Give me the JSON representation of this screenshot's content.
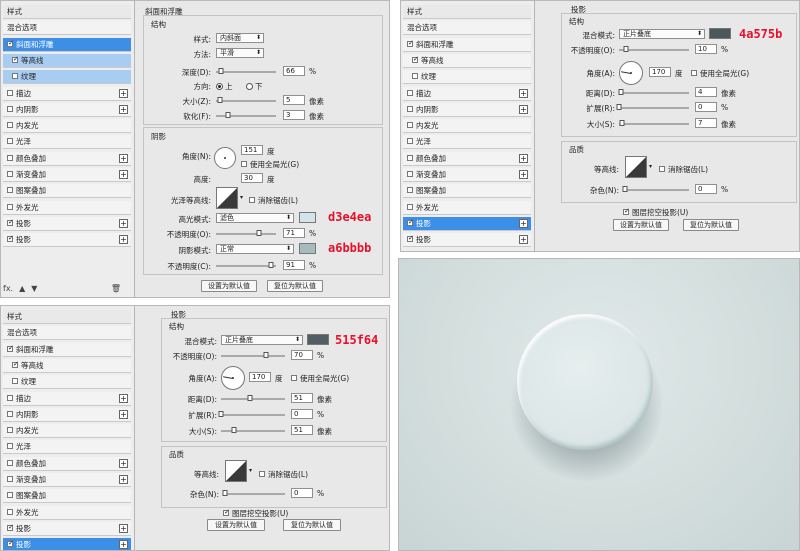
{
  "panel1": {
    "stylelist": {
      "items": [
        {
          "label": "样式",
          "checkbox": false,
          "checked": false,
          "plus": false
        },
        {
          "label": "混合选项",
          "checkbox": false,
          "checked": false,
          "plus": false
        },
        {
          "label": "斜面和浮雕",
          "checkbox": true,
          "checked": true,
          "plus": false,
          "selected": true
        },
        {
          "label": "等高线",
          "checkbox": true,
          "checked": true,
          "plus": false,
          "sub": true
        },
        {
          "label": "纹理",
          "checkbox": true,
          "checked": false,
          "plus": false,
          "sub": true
        },
        {
          "label": "描边",
          "checkbox": true,
          "checked": false,
          "plus": true
        },
        {
          "label": "内阴影",
          "checkbox": true,
          "checked": false,
          "plus": true
        },
        {
          "label": "内发光",
          "checkbox": true,
          "checked": false,
          "plus": false
        },
        {
          "label": "光泽",
          "checkbox": true,
          "checked": false,
          "plus": false
        },
        {
          "label": "颜色叠加",
          "checkbox": true,
          "checked": false,
          "plus": true
        },
        {
          "label": "渐变叠加",
          "checkbox": true,
          "checked": false,
          "plus": true
        },
        {
          "label": "图案叠加",
          "checkbox": true,
          "checked": false,
          "plus": false
        },
        {
          "label": "外发光",
          "checkbox": true,
          "checked": false,
          "plus": false
        },
        {
          "label": "投影",
          "checkbox": true,
          "checked": true,
          "plus": true
        },
        {
          "label": "投影",
          "checkbox": true,
          "checked": true,
          "plus": true
        }
      ],
      "footer_fx": "fx."
    },
    "title": "斜面和浮雕",
    "structure": {
      "heading": "结构",
      "style_label": "样式:",
      "style_value": "内斜面",
      "technique_label": "方法:",
      "technique_value": "平滑",
      "depth_label": "深度(D):",
      "depth_value": "66",
      "depth_unit": "%",
      "direction_label": "方向:",
      "direction_up": "上",
      "direction_down": "下",
      "size_label": "大小(Z):",
      "size_value": "5",
      "size_unit": "像素",
      "soften_label": "软化(F):",
      "soften_value": "3",
      "soften_unit": "像素"
    },
    "shading": {
      "heading": "阴影",
      "angle_label": "角度(N):",
      "angle_value": "151",
      "angle_unit": "度",
      "global_light": "使用全局光(G)",
      "altitude_label": "高度:",
      "altitude_value": "30",
      "altitude_unit": "度",
      "gloss_label": "光泽等高线:",
      "anti_alias": "消除锯齿(L)",
      "highlight_label": "高光模式:",
      "highlight_mode": "滤色",
      "highlight_color": "#d3e4ea",
      "highlight_hex": "d3e4ea",
      "opacity_label": "不透明度(O):",
      "highlight_opacity": "71",
      "shadow_label": "阴影模式:",
      "shadow_mode": "正常",
      "shadow_color": "#a6bbbb",
      "shadow_hex": "a6bbbb",
      "shadow_opacity_label": "不透明度(C):",
      "shadow_opacity": "91",
      "percent": "%"
    },
    "buttons": {
      "make_default": "设置为默认值",
      "reset_default": "复位为默认值"
    }
  },
  "panel2": {
    "stylelist": {
      "items": [
        {
          "label": "样式",
          "checkbox": false,
          "checked": false,
          "plus": false
        },
        {
          "label": "混合选项",
          "checkbox": false,
          "checked": false,
          "plus": false
        },
        {
          "label": "斜面和浮雕",
          "checkbox": true,
          "checked": true,
          "plus": false
        },
        {
          "label": "等高线",
          "checkbox": true,
          "checked": true,
          "plus": false,
          "sub": true
        },
        {
          "label": "纹理",
          "checkbox": true,
          "checked": false,
          "plus": false,
          "sub": true
        },
        {
          "label": "描边",
          "checkbox": true,
          "checked": false,
          "plus": true
        },
        {
          "label": "内阴影",
          "checkbox": true,
          "checked": false,
          "plus": true
        },
        {
          "label": "内发光",
          "checkbox": true,
          "checked": false,
          "plus": false
        },
        {
          "label": "光泽",
          "checkbox": true,
          "checked": false,
          "plus": false
        },
        {
          "label": "颜色叠加",
          "checkbox": true,
          "checked": false,
          "plus": true
        },
        {
          "label": "渐变叠加",
          "checkbox": true,
          "checked": false,
          "plus": true
        },
        {
          "label": "图案叠加",
          "checkbox": true,
          "checked": false,
          "plus": false
        },
        {
          "label": "外发光",
          "checkbox": true,
          "checked": false,
          "plus": false
        },
        {
          "label": "投影",
          "checkbox": true,
          "checked": true,
          "plus": true,
          "selected": true
        },
        {
          "label": "投影",
          "checkbox": true,
          "checked": true,
          "plus": true
        }
      ]
    },
    "title": "投影",
    "structure": {
      "heading": "结构",
      "blend_label": "混合模式:",
      "blend_value": "正片叠底",
      "color": "#4a575b",
      "hex": "4a575b",
      "opacity_label": "不透明度(O):",
      "opacity_value": "10",
      "angle_label": "角度(A):",
      "angle_value": "170",
      "angle_unit": "度",
      "global_light": "使用全局光(G)",
      "distance_label": "距离(D):",
      "distance_value": "4",
      "spread_label": "扩展(R):",
      "spread_value": "0",
      "size_label": "大小(S):",
      "size_value": "7",
      "px": "像素",
      "percent": "%"
    },
    "quality": {
      "heading": "品质",
      "contour_label": "等高线:",
      "anti_alias": "消除锯齿(L)",
      "noise_label": "杂色(N):",
      "noise_value": "0",
      "percent": "%"
    },
    "knockout": "图层挖空投影(U)",
    "buttons": {
      "make_default": "设置为默认值",
      "reset_default": "复位为默认值"
    }
  },
  "panel3": {
    "stylelist": {
      "items": [
        {
          "label": "样式",
          "checkbox": false,
          "checked": false,
          "plus": false
        },
        {
          "label": "混合选项",
          "checkbox": false,
          "checked": false,
          "plus": false
        },
        {
          "label": "斜面和浮雕",
          "checkbox": true,
          "checked": true,
          "plus": false
        },
        {
          "label": "等高线",
          "checkbox": true,
          "checked": true,
          "plus": false,
          "sub": true
        },
        {
          "label": "纹理",
          "checkbox": true,
          "checked": false,
          "plus": false,
          "sub": true
        },
        {
          "label": "描边",
          "checkbox": true,
          "checked": false,
          "plus": true
        },
        {
          "label": "内阴影",
          "checkbox": true,
          "checked": false,
          "plus": true
        },
        {
          "label": "内发光",
          "checkbox": true,
          "checked": false,
          "plus": false
        },
        {
          "label": "光泽",
          "checkbox": true,
          "checked": false,
          "plus": false
        },
        {
          "label": "颜色叠加",
          "checkbox": true,
          "checked": false,
          "plus": true
        },
        {
          "label": "渐变叠加",
          "checkbox": true,
          "checked": false,
          "plus": true
        },
        {
          "label": "图案叠加",
          "checkbox": true,
          "checked": false,
          "plus": false
        },
        {
          "label": "外发光",
          "checkbox": true,
          "checked": false,
          "plus": false
        },
        {
          "label": "投影",
          "checkbox": true,
          "checked": true,
          "plus": true
        },
        {
          "label": "投影",
          "checkbox": true,
          "checked": true,
          "plus": true,
          "selected": true
        }
      ]
    },
    "title": "投影",
    "structure": {
      "heading": "结构",
      "blend_label": "混合模式:",
      "blend_value": "正片叠底",
      "color": "#515f64",
      "hex": "515f64",
      "opacity_label": "不透明度(O):",
      "opacity_value": "70",
      "angle_label": "角度(A):",
      "angle_value": "170",
      "angle_unit": "度",
      "global_light": "使用全局光(G)",
      "distance_label": "距离(D):",
      "distance_value": "51",
      "spread_label": "扩展(R):",
      "spread_value": "0",
      "size_label": "大小(S):",
      "size_value": "51",
      "px": "像素",
      "percent": "%"
    },
    "quality": {
      "heading": "品质",
      "contour_label": "等高线:",
      "anti_alias": "消除锯齿(L)",
      "noise_label": "杂色(N):",
      "noise_value": "0",
      "percent": "%"
    },
    "knockout": "图层挖空投影(U)",
    "buttons": {
      "make_default": "设置为默认值",
      "reset_default": "复位为默认值"
    }
  },
  "preview": {
    "background": "#d3dedd"
  }
}
